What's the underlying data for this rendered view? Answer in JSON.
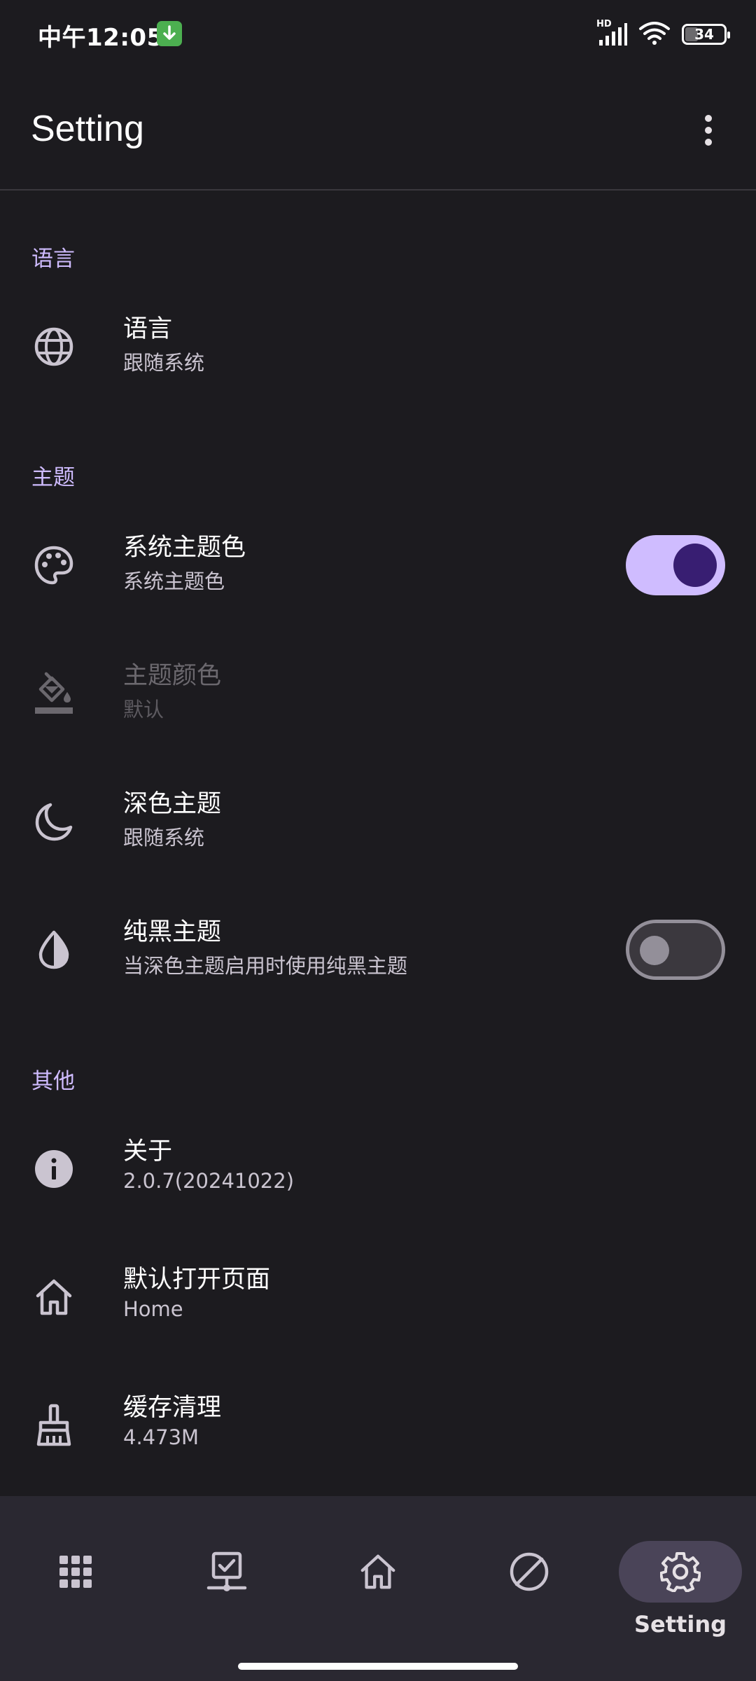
{
  "status_bar": {
    "time": "中午12:05",
    "battery": "34",
    "battery_level_percent": 34,
    "hd_label": "HD"
  },
  "app_bar": {
    "title": "Setting"
  },
  "sections": {
    "language": {
      "header": "语言",
      "items": [
        {
          "title": "语言",
          "subtitle": "跟随系统",
          "icon": "globe-icon"
        }
      ]
    },
    "theme": {
      "header": "主题",
      "items": [
        {
          "title": "系统主题色",
          "subtitle": "系统主题色",
          "icon": "palette-icon",
          "switch": true
        },
        {
          "title": "主题颜色",
          "subtitle": "默认",
          "icon": "paint-bucket-icon",
          "disabled": true
        },
        {
          "title": "深色主题",
          "subtitle": "跟随系统",
          "icon": "moon-icon"
        },
        {
          "title": "纯黑主题",
          "subtitle": "当深色主题启用时使用纯黑主题",
          "icon": "contrast-drop-icon",
          "switch": false
        }
      ]
    },
    "other": {
      "header": "其他",
      "items": [
        {
          "title": "关于",
          "subtitle": "2.0.7(20241022)",
          "icon": "info-icon"
        },
        {
          "title": "默认打开页面",
          "subtitle": "Home",
          "icon": "home-icon"
        },
        {
          "title": "缓存清理",
          "subtitle": "4.473M",
          "icon": "broom-icon"
        }
      ]
    }
  },
  "bottom_nav": {
    "items": [
      {
        "icon": "apps-grid-icon"
      },
      {
        "icon": "device-check-icon"
      },
      {
        "icon": "home-icon"
      },
      {
        "icon": "block-icon"
      },
      {
        "icon": "gear-icon",
        "label": "Setting",
        "selected": true
      }
    ]
  },
  "colors": {
    "background": "#1c1b1f",
    "accent": "#cfbcff",
    "switch_knob_on": "#381e72",
    "nav_background": "#2a2831",
    "nav_selected_pill": "#4a4458"
  }
}
